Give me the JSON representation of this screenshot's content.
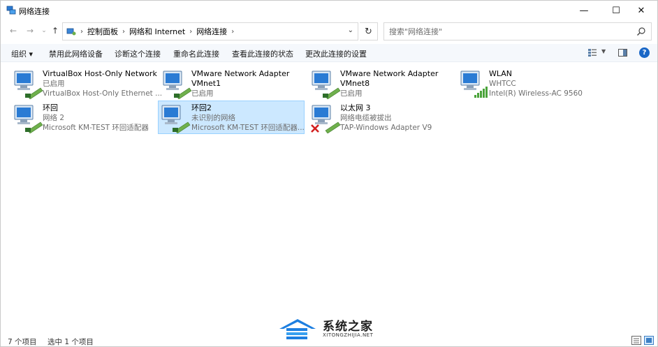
{
  "window": {
    "title": "网络连接",
    "controls": {
      "minimize": "—",
      "maximize": "☐",
      "close": "✕"
    }
  },
  "address": {
    "crumbs": [
      "控制面板",
      "网络和 Internet",
      "网络连接"
    ],
    "search_placeholder": "搜索\"网络连接\""
  },
  "toolbar": {
    "organize": "组织 ▾",
    "disable": "禁用此网络设备",
    "diagnose": "诊断这个连接",
    "rename": "重命名此连接",
    "status": "查看此连接的状态",
    "change": "更改此连接的设置",
    "help": "?"
  },
  "connections": [
    {
      "name": "VirtualBox Host-Only Network",
      "line2": "已启用",
      "line3": "VirtualBox Host-Only Ethernet ...",
      "icon": "network-adapter-icon"
    },
    {
      "name": "VMware Network Adapter",
      "line2": "VMnet1",
      "line3": "已启用",
      "icon": "network-adapter-icon"
    },
    {
      "name": "VMware Network Adapter",
      "line2": "VMnet8",
      "line3": "已启用",
      "icon": "network-adapter-icon"
    },
    {
      "name": "WLAN",
      "line2": "WHTCC",
      "line3": "Intel(R) Wireless-AC 9560",
      "icon": "wifi-adapter-icon"
    },
    {
      "name": "环回",
      "line2": "网络 2",
      "line3": "Microsoft KM-TEST 环回适配器",
      "icon": "network-adapter-icon"
    },
    {
      "name": "环回2",
      "line2": "未识别的网络",
      "line3": "Microsoft KM-TEST 环回适配器...",
      "icon": "network-adapter-icon",
      "selected": true
    },
    {
      "name": "以太网 3",
      "line2": "网络电缆被拔出",
      "line3": "TAP-Windows Adapter V9",
      "icon": "disconnected-adapter-icon"
    }
  ],
  "status": {
    "count": "7 个项目",
    "selected": "选中 1 个项目"
  },
  "watermark": {
    "name": "系统之家",
    "url": "XITONGZHIJIA.NET"
  }
}
